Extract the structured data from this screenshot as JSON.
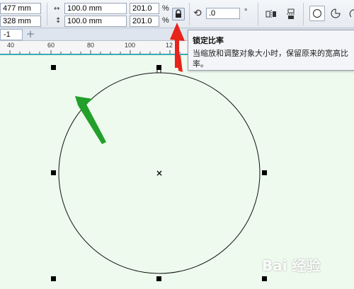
{
  "propbar": {
    "x_value": "477 mm",
    "y_value": "328 mm",
    "width_value": "100.0 mm",
    "height_value": "100.0 mm",
    "width_scale": "201.0",
    "height_scale": "201.0",
    "percent_symbol": "%",
    "rotation_value": ".0",
    "degree_symbol": "°"
  },
  "tabs": {
    "page_label": "-1",
    "add_label": "+"
  },
  "ruler": {
    "labels": [
      "40",
      "60",
      "80",
      "100",
      "12"
    ]
  },
  "tooltip": {
    "title": "锁定比率",
    "description": "当缩放和调整对象大小时，保留原来的宽高比率。"
  },
  "watermark": "Bai 经验",
  "colors": {
    "canvas_bg": "#eefaee",
    "ruler_line": "#3aa9b5",
    "arrow_green": "#22a02a",
    "arrow_red": "#e8231a"
  }
}
